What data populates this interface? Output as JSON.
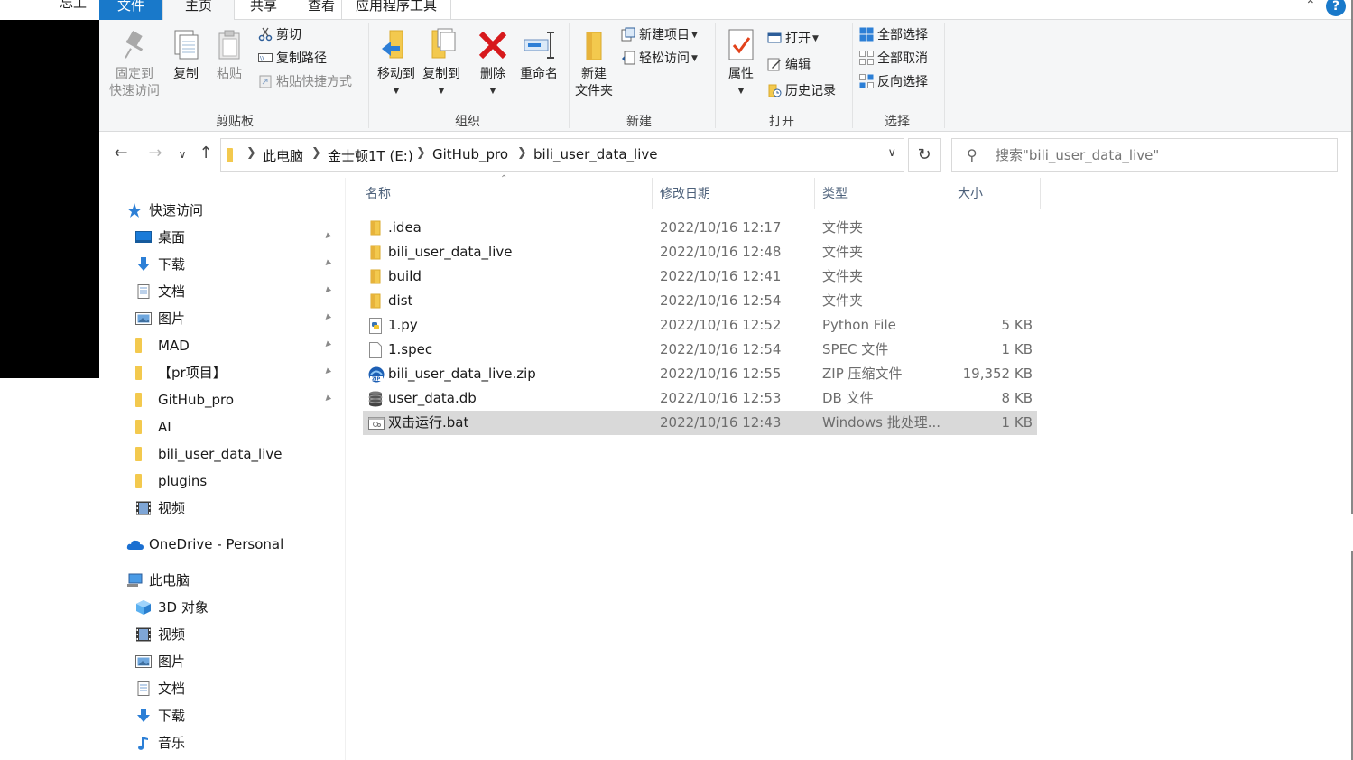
{
  "background": {
    "partial_text": "忘工"
  },
  "tabs": {
    "file": "文件",
    "home": "主页",
    "share": "共享",
    "view": "查看",
    "app_tools": "应用程序工具",
    "help": "?"
  },
  "ribbon": {
    "clipboard": {
      "label": "剪贴板",
      "pin": "固定到\n快速访问",
      "copy": "复制",
      "paste": "粘贴",
      "cut": "剪切",
      "copy_path": "复制路径",
      "paste_shortcut": "粘贴快捷方式"
    },
    "organize": {
      "label": "组织",
      "move_to": "移动到",
      "copy_to": "复制到",
      "delete": "删除",
      "rename": "重命名"
    },
    "new": {
      "label": "新建",
      "new_folder": "新建\n文件夹",
      "new_item": "新建项目",
      "easy_access": "轻松访问"
    },
    "open": {
      "label": "打开",
      "properties": "属性",
      "open": "打开",
      "edit": "编辑",
      "history": "历史记录"
    },
    "select": {
      "label": "选择",
      "select_all": "全部选择",
      "select_none": "全部取消",
      "invert": "反向选择"
    }
  },
  "address": {
    "crumbs": [
      "此电脑",
      "金士顿1T (E:)",
      "GitHub_pro",
      "bili_user_data_live"
    ]
  },
  "search": {
    "placeholder": "搜索\"bili_user_data_live\""
  },
  "navpane": {
    "quick_access": "快速访问",
    "quick_items": [
      {
        "label": "桌面",
        "icon": "desktop-icon",
        "pinned": true
      },
      {
        "label": "下载",
        "icon": "download-icon",
        "pinned": true
      },
      {
        "label": "文档",
        "icon": "document-icon",
        "pinned": true
      },
      {
        "label": "图片",
        "icon": "pictures-icon",
        "pinned": true
      },
      {
        "label": "MAD",
        "icon": "folder-icon",
        "pinned": true
      },
      {
        "label": "【pr项目】",
        "icon": "folder-icon",
        "pinned": true
      },
      {
        "label": "GitHub_pro",
        "icon": "folder-icon",
        "pinned": true
      },
      {
        "label": "AI",
        "icon": "folder-icon",
        "pinned": false
      },
      {
        "label": "bili_user_data_live",
        "icon": "folder-icon",
        "pinned": false
      },
      {
        "label": "plugins",
        "icon": "folder-icon",
        "pinned": false
      },
      {
        "label": "视频",
        "icon": "video-icon",
        "pinned": false
      }
    ],
    "onedrive": "OneDrive - Personal",
    "this_pc": "此电脑",
    "pc_items": [
      {
        "label": "3D 对象",
        "icon": "3d-objects-icon"
      },
      {
        "label": "视频",
        "icon": "video-icon"
      },
      {
        "label": "图片",
        "icon": "pictures-icon"
      },
      {
        "label": "文档",
        "icon": "document-icon"
      },
      {
        "label": "下载",
        "icon": "download-icon"
      },
      {
        "label": "音乐",
        "icon": "music-icon"
      }
    ]
  },
  "columns": {
    "name": "名称",
    "date": "修改日期",
    "type": "类型",
    "size": "大小"
  },
  "files": [
    {
      "name": ".idea",
      "date": "2022/10/16 12:17",
      "type": "文件夹",
      "size": "",
      "icon": "folder"
    },
    {
      "name": "bili_user_data_live",
      "date": "2022/10/16 12:48",
      "type": "文件夹",
      "size": "",
      "icon": "folder"
    },
    {
      "name": "build",
      "date": "2022/10/16 12:41",
      "type": "文件夹",
      "size": "",
      "icon": "folder"
    },
    {
      "name": "dist",
      "date": "2022/10/16 12:54",
      "type": "文件夹",
      "size": "",
      "icon": "folder"
    },
    {
      "name": "1.py",
      "date": "2022/10/16 12:52",
      "type": "Python File",
      "size": "5 KB",
      "icon": "python"
    },
    {
      "name": "1.spec",
      "date": "2022/10/16 12:54",
      "type": "SPEC 文件",
      "size": "1 KB",
      "icon": "file"
    },
    {
      "name": "bili_user_data_live.zip",
      "date": "2022/10/16 12:55",
      "type": "ZIP 压缩文件",
      "size": "19,352 KB",
      "icon": "zip"
    },
    {
      "name": "user_data.db",
      "date": "2022/10/16 12:53",
      "type": "DB 文件",
      "size": "8 KB",
      "icon": "database"
    },
    {
      "name": "双击运行.bat",
      "date": "2022/10/16 12:43",
      "type": "Windows 批处理...",
      "size": "1 KB",
      "icon": "batch",
      "selected": true
    }
  ],
  "colors": {
    "accent": "#1979ca",
    "selected_row": "#d9d9d9",
    "folder": "#f8d775",
    "delete_red": "#d7191c"
  }
}
